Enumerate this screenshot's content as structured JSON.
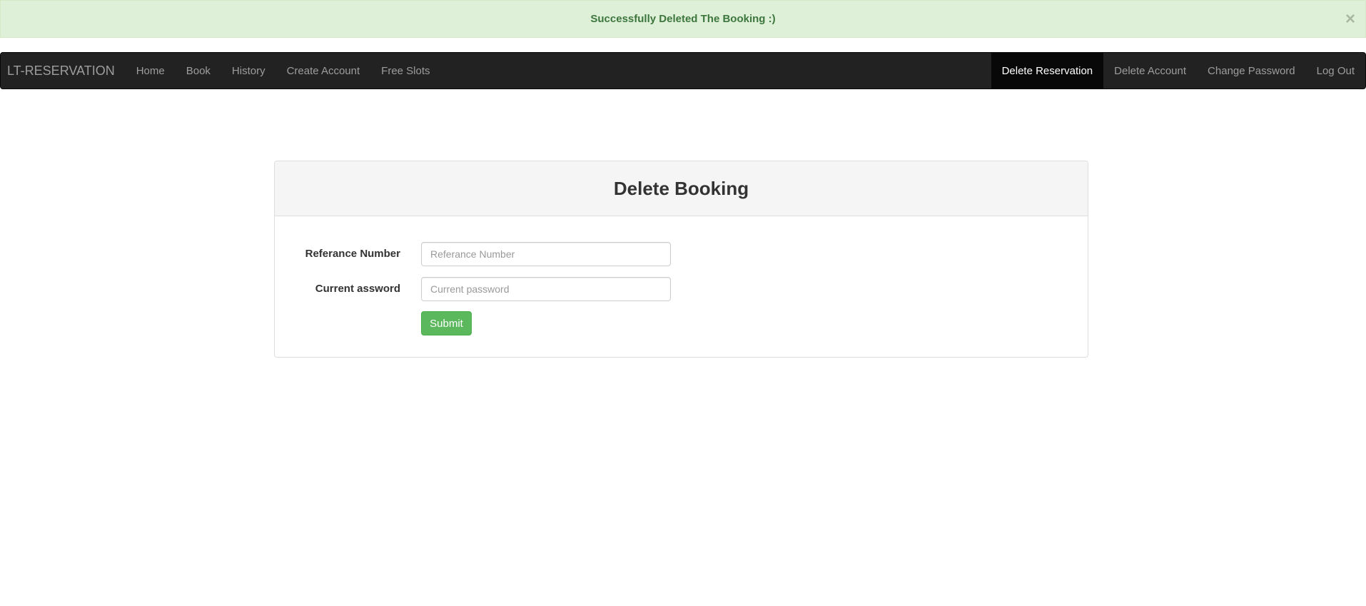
{
  "alert": {
    "message": "Successfully Deleted The Booking :)",
    "close_glyph": "×",
    "color": "#3c763d",
    "background": "#dff0d8"
  },
  "navbar": {
    "brand": "LT-RESERVATION",
    "left_items": [
      {
        "label": "Home"
      },
      {
        "label": "Book"
      },
      {
        "label": "History"
      },
      {
        "label": "Create Account"
      },
      {
        "label": "Free Slots"
      }
    ],
    "right_items": [
      {
        "label": "Delete Reservation",
        "active": true
      },
      {
        "label": "Delete Account"
      },
      {
        "label": "Change Password"
      },
      {
        "label": "Log Out"
      }
    ]
  },
  "panel": {
    "title": "Delete Booking",
    "fields": [
      {
        "label": "Referance Number",
        "placeholder": "Referance Number",
        "value": ""
      },
      {
        "label": "Current assword",
        "placeholder": "Current password",
        "value": ""
      }
    ],
    "submit_label": "Submit",
    "submit_color": "#5cb85c"
  }
}
